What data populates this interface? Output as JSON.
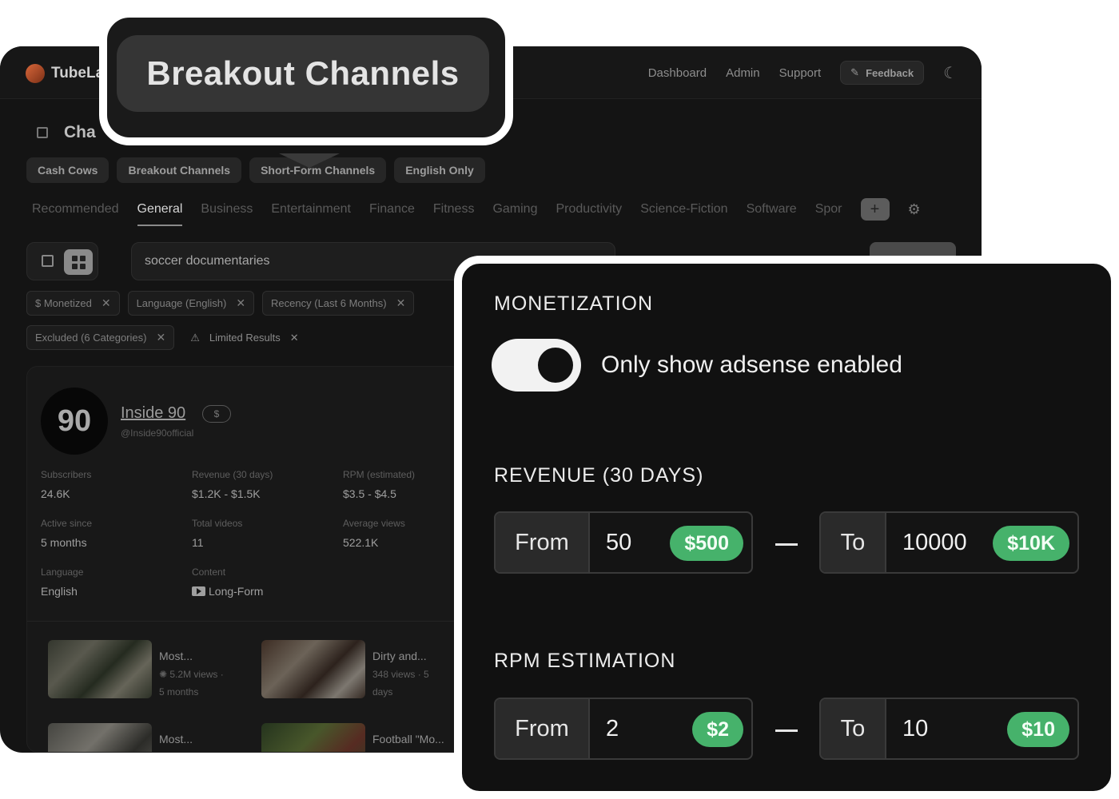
{
  "app": {
    "brand": "TubeLa",
    "nav": [
      "Dashboard",
      "Admin",
      "Support"
    ],
    "feedback_label": "Feedback",
    "page_title": "Cha"
  },
  "presets": [
    "Cash Cows",
    "Breakout Channels",
    "Short-Form Channels",
    "English Only"
  ],
  "categories": [
    "Recommended",
    "General",
    "Business",
    "Entertainment",
    "Finance",
    "Fitness",
    "Gaming",
    "Productivity",
    "Science-Fiction",
    "Software",
    "Spor"
  ],
  "active_category": "General",
  "search": {
    "value": "soccer documentaries"
  },
  "filters": {
    "row1": [
      "$ Monetized",
      "Language (English)",
      "Recency (Last 6 Months)"
    ],
    "row2": [
      "Excluded (6 Categories)"
    ],
    "warning": "Limited Results"
  },
  "channel": {
    "avatar_text": "90",
    "name": "Inside 90",
    "badge": "$",
    "handle": "@Inside90official",
    "stats": [
      {
        "label": "Subscribers",
        "value": "24.6K"
      },
      {
        "label": "Revenue (30 days)",
        "value": "$1.2K - $1.5K"
      },
      {
        "label": "RPM (estimated)",
        "value": "$3.5 - $4.5"
      },
      {
        "label": "Active since",
        "value": "5 months"
      },
      {
        "label": "Total videos",
        "value": "11"
      },
      {
        "label": "Average views",
        "value": "522.1K"
      },
      {
        "label": "Language",
        "value": "English"
      },
      {
        "label": "Content",
        "value": "Long-Form"
      }
    ],
    "videos": [
      {
        "title": "Most...",
        "meta1": "5.2M views ·",
        "meta2": "5 months"
      },
      {
        "title": "Dirty and...",
        "meta1": "348 views · 5",
        "meta2": "days"
      },
      {
        "title": "Most...",
        "meta1": "",
        "meta2": ""
      },
      {
        "title": "Football \"Mo...",
        "meta1": "",
        "meta2": ""
      }
    ]
  },
  "callout": {
    "title": "Breakout Channels"
  },
  "panel": {
    "monetization": {
      "title": "MONETIZATION",
      "toggle_label": "Only show adsense enabled",
      "toggle_on": true
    },
    "revenue": {
      "title": "REVENUE (30 DAYS)",
      "from_label": "From",
      "from_value": "50",
      "from_pill": "$500",
      "to_label": "To",
      "to_value": "10000",
      "to_pill": "$10K"
    },
    "rpm": {
      "title": "RPM ESTIMATION",
      "from_label": "From",
      "from_value": "2",
      "from_pill": "$2",
      "to_label": "To",
      "to_value": "10",
      "to_pill": "$10"
    },
    "accent_color": "#46b26b"
  }
}
